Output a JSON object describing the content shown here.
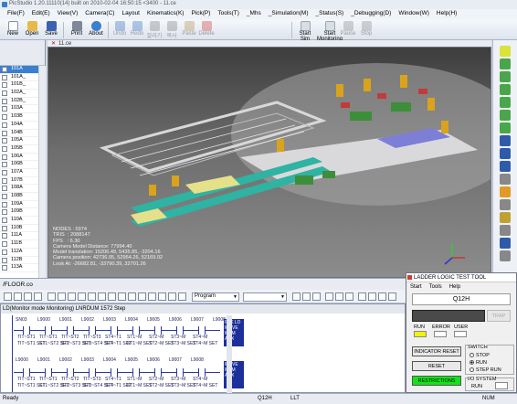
{
  "window": {
    "title": "PicStudio 1.20.11110(14) built on 2010-02-04 16:50:15 <3400 - 11.ce"
  },
  "menu": [
    "File(F)",
    "Edit(E)",
    "View(V)",
    "Camera(C)",
    "Layout",
    "Kinematics(K)",
    "Pick(P)",
    "Tools(T)",
    "_Mhs",
    "_Simulation(M)",
    "_Status(S)",
    "_Debugging(D)",
    "Window(W)",
    "Help(H)"
  ],
  "toolbar": {
    "new": "New",
    "open": "Open",
    "save": "Save",
    "print": "Print",
    "about": "About",
    "undo": "Undo",
    "redo": "Redo",
    "cut": "잘라기",
    "copy": "복사",
    "paste": "Paste",
    "delete": "Delete",
    "start_sim_1": "Start",
    "start_sim_2": "Sim",
    "start_mon_1": "Start",
    "start_mon_2": "Monitoring",
    "pause": "Pause",
    "stop": "Stop"
  },
  "left_panel": {
    "rows": [
      "101A",
      "101A_",
      "101B_",
      "102A_",
      "102B_",
      "103A",
      "103B",
      "104A",
      "104B",
      "105A",
      "105B",
      "106A",
      "106B",
      "107A",
      "107B",
      "108A",
      "108B",
      "109A",
      "109B",
      "110A",
      "110B",
      "111A",
      "111B",
      "112A",
      "112B",
      "113A"
    ],
    "selected_index": 0
  },
  "viewport": {
    "tab_label": "11.ce",
    "stats": "NODES : 5974\nTRIS  : 2088147\nFPS   : 6.30\nCamera Model Distance: 77994.40\nModel translation: 15206.49, 5435.85, -3204.16\nCamera position: 42736.05, 52964.26, 52169.02\nLook At: -26682.81, -33790.39, 32701.26"
  },
  "floor_tab": "/FLOOR.co",
  "ladder_toolbar": {
    "program_select": "Program"
  },
  "ladder": {
    "header": "LD(Monitor mode Monitoring)    LNRDUM    1572 Step",
    "top_labels": [
      "SN03",
      "L9000",
      "L9001",
      "L9002",
      "L9003",
      "L9004",
      "L9005",
      "L9006",
      "L9007",
      "L9008"
    ],
    "rung1_labels": [
      "TIT~ST1",
      "TIT~ST1",
      "TIT~ST2",
      "TIT~ST3",
      "ST4~T1",
      "ST1~M",
      "ST2~M",
      "ST3~M",
      "ST4~M"
    ],
    "rung1_sub": [
      "TIT~ST1 SET",
      "ST1~ST2 SET",
      "ST2~ST3 SET",
      "ST3~ST4 SET",
      "ST4~T1 SET",
      "ST1~M SET",
      "ST2~M SET",
      "ST3~M SET",
      "ST4~M SET"
    ],
    "coil1": "PAK LD MOVE MEM AUX",
    "mid_labels": [
      "L9000",
      "L9001",
      "L9002",
      "L9003",
      "L9004",
      "L9005",
      "L9006",
      "L9007",
      "L9008"
    ],
    "coil2": "MOVE MEM AUX"
  },
  "status_bar": {
    "ready": "Ready",
    "q12h": "Q12H",
    "llt": "LLT",
    "num": "NUM"
  },
  "ladder_test_tool": {
    "title": "LADDER LOGIC TEST TOOL",
    "menu": [
      "Start",
      "Tools",
      "Help"
    ],
    "cpu": "Q12H",
    "trap": "TRAP",
    "indicators": [
      "RUN",
      "ERROR",
      "USER"
    ],
    "indicator_reset": "INDICATOR RESET",
    "reset": "RESET",
    "restrictions": "RESTRICTIONS",
    "switch_label": "SWITCH",
    "switch_options": [
      "STOP",
      "RUN",
      "STEP RUN"
    ],
    "switch_selected": "RUN",
    "io_label": "I/O SYSTEM",
    "io_run": "RUN"
  },
  "colors": {
    "accent": "#3b7fcf",
    "run_lamp": "#f2f20a",
    "restrictions": "#12e21a",
    "ladder_blue": "#1c2f9a"
  }
}
